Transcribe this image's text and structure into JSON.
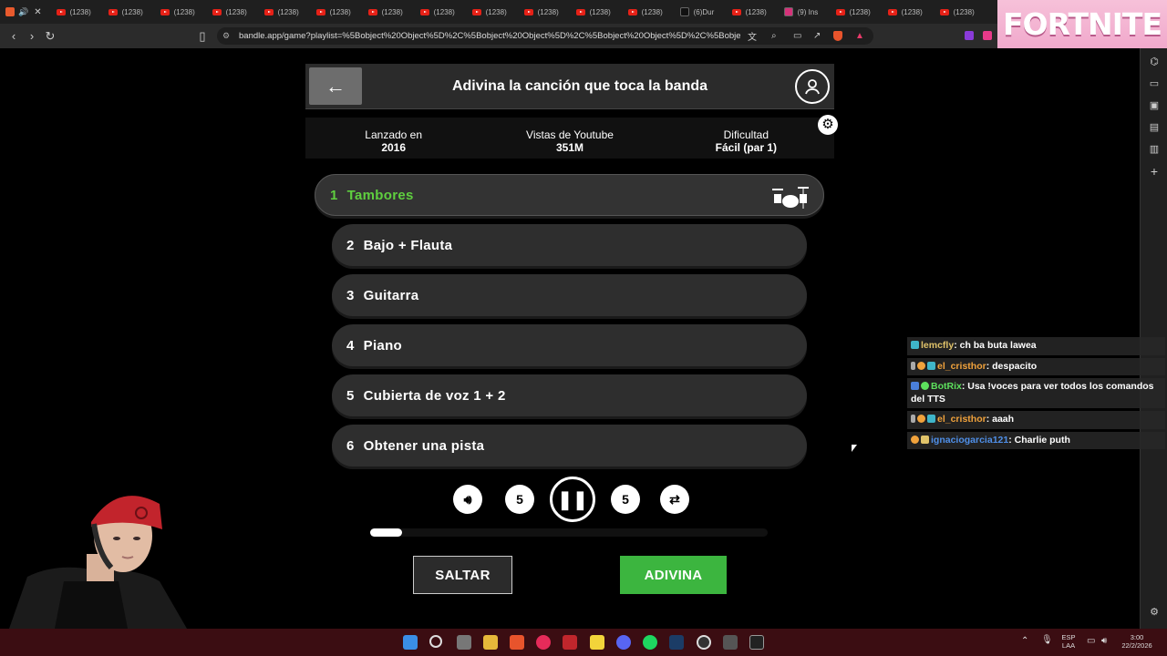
{
  "browser": {
    "tabs": [
      {
        "label": "(1238)",
        "icon": "youtube-icon"
      },
      {
        "label": "(1238)",
        "icon": "youtube-icon"
      },
      {
        "label": "(1238)",
        "icon": "youtube-icon"
      },
      {
        "label": "(1238)",
        "icon": "youtube-icon"
      },
      {
        "label": "(1238)",
        "icon": "youtube-icon"
      },
      {
        "label": "(1238)",
        "icon": "youtube-icon"
      },
      {
        "label": "(1238)",
        "icon": "youtube-icon"
      },
      {
        "label": "(1238)",
        "icon": "youtube-icon"
      },
      {
        "label": "(1238)",
        "icon": "youtube-icon"
      },
      {
        "label": "(1238)",
        "icon": "youtube-icon"
      },
      {
        "label": "(1238)",
        "icon": "youtube-icon"
      },
      {
        "label": "(1238)",
        "icon": "youtube-icon"
      },
      {
        "label": "(6)Dur",
        "icon": "tiktok-icon"
      },
      {
        "label": "(1238)",
        "icon": "youtube-icon"
      },
      {
        "label": "(9) Ins",
        "icon": "instagram-icon"
      },
      {
        "label": "(1238)",
        "icon": "youtube-icon"
      },
      {
        "label": "(1238)",
        "icon": "youtube-icon"
      },
      {
        "label": "(1238)",
        "icon": "youtube-icon"
      }
    ],
    "url": "bandle.app/game?playlist=%5Bobject%20Object%5D%2C%5Bobject%20Object%5D%2C%5Bobject%20Object%5D%2C%5Bobject%20Object%5D%2C%5Bobject%..."
  },
  "overlay": {
    "fortnite": "FORTNITE"
  },
  "game": {
    "title": "Adivina la canción que toca la banda",
    "stats": [
      {
        "label": "Lanzado en",
        "value": "2016"
      },
      {
        "label": "Vistas de Youtube",
        "value": "351M"
      },
      {
        "label": "Dificultad",
        "value": "Fácil (par 1)"
      }
    ],
    "tracks": [
      {
        "num": "1",
        "label": "Tambores"
      },
      {
        "num": "2",
        "label": "Bajo + Flauta"
      },
      {
        "num": "3",
        "label": "Guitarra"
      },
      {
        "num": "4",
        "label": "Piano"
      },
      {
        "num": "5",
        "label": "Cubierta de voz 1 + 2"
      },
      {
        "num": "6",
        "label": "Obtener una pista"
      }
    ],
    "progress": 0.08,
    "skip_label": "SALTAR",
    "guess_label": "ADIVINA",
    "rewind_label": "5",
    "forward_label": "5"
  },
  "chat": [
    {
      "user": "lemcfly",
      "user_color": "#e0c36a",
      "msg": ": ch ba buta lawea"
    },
    {
      "user": "el_cristhor",
      "user_color": "#f0a23c",
      "msg": ": despacito"
    },
    {
      "user": "BotRix",
      "user_color": "#5de05d",
      "msg": ": Usa !voces para ver todos los comandos del TTS"
    },
    {
      "user": "el_cristhor",
      "user_color": "#f0a23c",
      "msg": ": aaah"
    },
    {
      "user": "ignaciogarcia121",
      "user_color": "#4f8fe8",
      "msg": ": Charlie puth"
    }
  ],
  "taskbar": {
    "lang": "ESP",
    "layout": "LAA",
    "time": "3:00",
    "date": "22/2/2026"
  }
}
